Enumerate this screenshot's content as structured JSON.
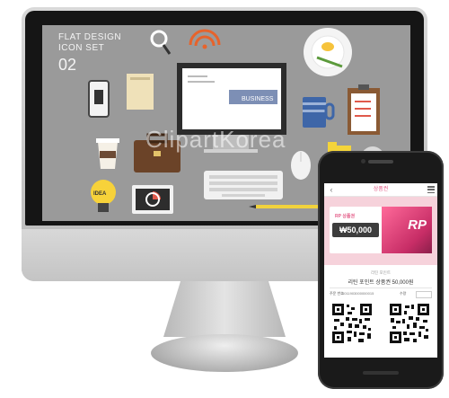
{
  "monitor": {
    "title": "FLAT DESIGN",
    "subtitle": "ICON SET",
    "number": "02",
    "monitor_label": "BUSINESS",
    "idea_label": "IDEA",
    "watermark": "ClipartKorea"
  },
  "phone": {
    "app_title": "상품권",
    "back": "‹",
    "ticket": {
      "badge": "RP 상품권",
      "amount": "₩50,000",
      "logo": "RP"
    },
    "info_label": "리틴 포인트",
    "info_title": "리틴 포인트 상품권 50,000원",
    "row": {
      "code_label": "주문 번호",
      "code_value": "1011903000000015",
      "qty_label": "수량"
    }
  },
  "colors": {
    "screen_bg": "#9a9a9a",
    "accent_pink": "#e35a86",
    "ticket_area": "#f6d2db"
  }
}
